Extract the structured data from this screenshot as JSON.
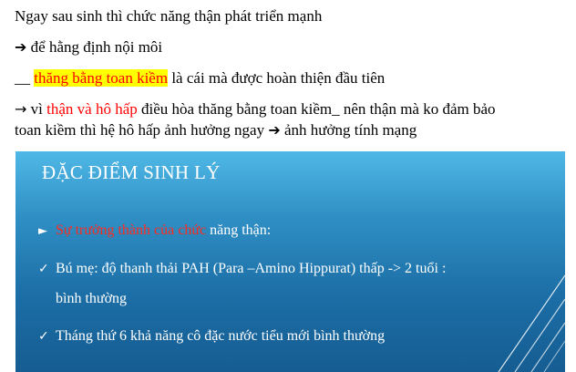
{
  "text": {
    "line1": "Ngay sau sinh thì chức năng thận phát triển mạnh",
    "line2_text": " để hằng định nội môi",
    "line3_prefix": "__ ",
    "line3_highlight": "thăng bằng toan kiềm",
    "line3_rest": " là cái mà được hoàn thiện đầu tiên",
    "line4_pre": " vì ",
    "line4_red": "thận và hô hấp",
    "line4_rest": " điều hòa thăng bằng toan kiềm_ nên thận mà ko đảm bảo",
    "line5_text": "toan kiềm thì hệ hô hấp ảnh hưởng ngay ",
    "line5_after": " ảnh hưởng tính mạng"
  },
  "icons": {
    "bold_arrow": "➔",
    "thin_arrow": "→",
    "triangle_bullet": "►",
    "check_bullet": "✓"
  },
  "slide": {
    "title": "ĐẶC ĐIỂM SINH LÝ",
    "bullet1_red": "Sự trưởng thành của chức",
    "bullet1_rest": " năng thận:",
    "bullet2": "Bú mẹ: độ thanh thải PAH (Para –Amino Hippurat) thấp -> 2 tuổi :",
    "bullet2_cont": "bình thường",
    "bullet3": "Tháng thứ 6 khả năng cô đặc nước tiểu mới bình thường"
  },
  "colors": {
    "highlight": "#ffff00",
    "red_text": "#ff0000",
    "slide_top": "#4fb8e6",
    "slide_bottom": "#155d92"
  }
}
